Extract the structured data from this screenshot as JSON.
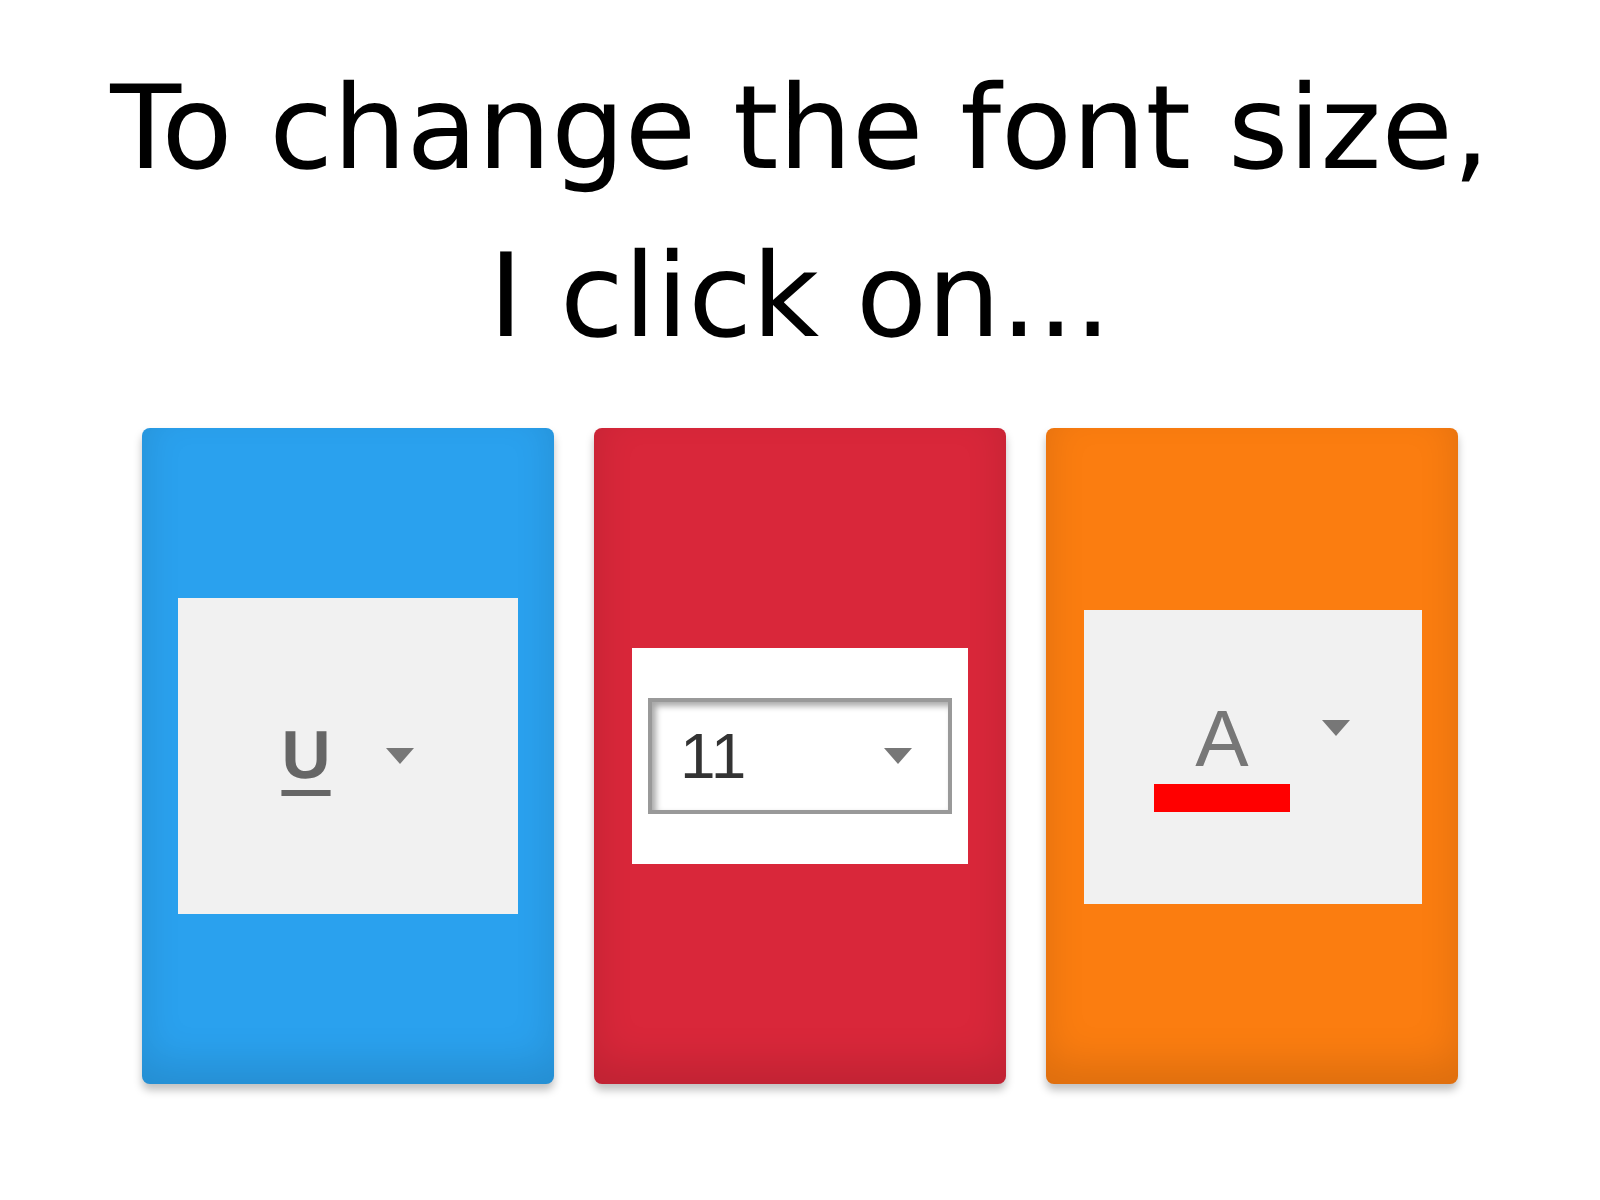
{
  "question": "To change the font size, I click on...",
  "answers": [
    {
      "kind": "underline",
      "glyph": "U",
      "color": "#2aa1ee"
    },
    {
      "kind": "font-size",
      "value": "11",
      "color": "#d9273a"
    },
    {
      "kind": "font-color",
      "glyph": "A",
      "color": "#fb7d10"
    }
  ]
}
